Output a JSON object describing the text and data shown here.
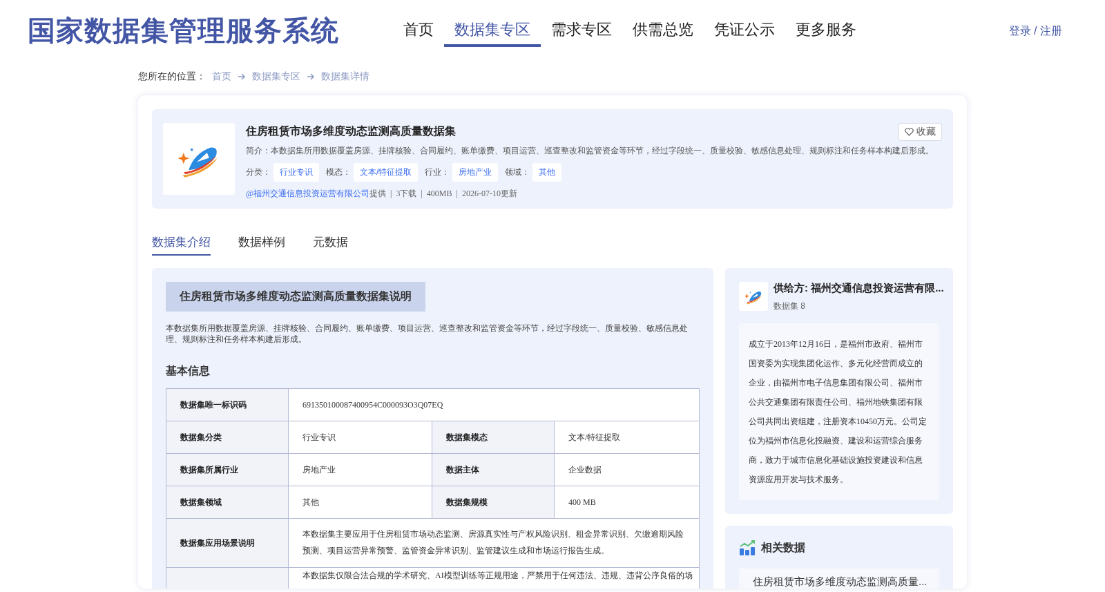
{
  "header": {
    "title": "国家数据集管理服务系统",
    "login": "登录 / 注册",
    "nav": [
      {
        "label": "首页",
        "selected": false
      },
      {
        "label": "数据集专区",
        "selected": true
      },
      {
        "label": "需求专区",
        "selected": false
      },
      {
        "label": "供需总览",
        "selected": false
      },
      {
        "label": "凭证公示",
        "selected": false
      },
      {
        "label": "更多服务",
        "selected": false
      }
    ]
  },
  "breadcrumb": {
    "label": "您所在的位置：",
    "items": [
      "首页",
      "数据集专区",
      "数据集详情"
    ]
  },
  "dataset": {
    "title": "住房租赁市场多维度动态监测高质量数据集",
    "favorite": "收藏",
    "summary": "简介：本数据集所用数据覆盖房源、挂牌核验、合同履约、账单缴费、项目运营、巡查整改和监管资金等环节，经过字段统一、质量校验、敏感信息处理、规则标注和任务样本构建后形成。",
    "tags": [
      {
        "label": "分类：",
        "value": "行业专识"
      },
      {
        "label": "模态：",
        "value": "文本/特征提取"
      },
      {
        "label": "行业：",
        "value": "房地产业"
      },
      {
        "label": "领域：",
        "value": "其他"
      }
    ],
    "provider": "@福州交通信息投资运营有限公司",
    "provider_suffix": "提供  |  3下载  |  400MB  |  2026-07-10更新"
  },
  "tabs": [
    {
      "label": "数据集介绍",
      "selected": true
    },
    {
      "label": "数据样例",
      "selected": false
    },
    {
      "label": "元数据",
      "selected": false
    }
  ],
  "description": {
    "heading": "住房租赁市场多维度动态监测高质量数据集说明",
    "text": "本数据集所用数据覆盖房源、挂牌核验、合同履约、账单缴费、项目运营、巡查整改和监管资金等环节，经过字段统一、质量校验、敏感信息处理、规则标注和任务样本构建后形成。",
    "section": "基本信息",
    "rows": [
      [
        "数据集唯一标识码",
        {
          "text": "691350100087400954C000093O3Q07EQ",
          "colspan": 3
        }
      ],
      [
        "数据集分类",
        "行业专识",
        "数据集模态",
        "文本/特征提取"
      ],
      [
        "数据集所属行业",
        "房地产业",
        "数据主体",
        "企业数据"
      ],
      [
        "数据集领域",
        "其他",
        "数据集规模",
        "400 MB"
      ],
      [
        "数据集应用场景说明",
        {
          "colspan": 3,
          "text": "本数据集主要应用于住房租赁市场动态监测、房源真实性与产权风险识别、租金异常识别、欠缴逾期风险预测、项目运营异常预警、监管资金异常识别、监管建议生成和市场运行报告生成。"
        }
      ],
      [
        "",
        {
          "colspan": 3,
          "text": "本数据集仅限合法合规的学术研究、AI模型训练等正规用途，严禁用于任何违法、违规、违背公序良俗的场"
        }
      ]
    ]
  },
  "supplier": {
    "name": "供给方: 福州交通信息投资运营有限...",
    "count": "数据集 8",
    "about": "成立于2013年12月16日，是福州市政府、福州市国资委为实现集团化运作、多元化经营而成立的企业，由福州市电子信息集团有限公司、福州市公共交通集团有限责任公司、福州地铁集团有限公司共同出资组建，注册资本10450万元。公司定位为福州市信息化投融资、建设和运营综合服务商，致力于城市信息化基础设施投资建设和信息资源应用开发与技术服务。"
  },
  "related": {
    "title": "相关数据",
    "items": [
      "住房租赁市场多维度动态监测高质量..."
    ]
  }
}
